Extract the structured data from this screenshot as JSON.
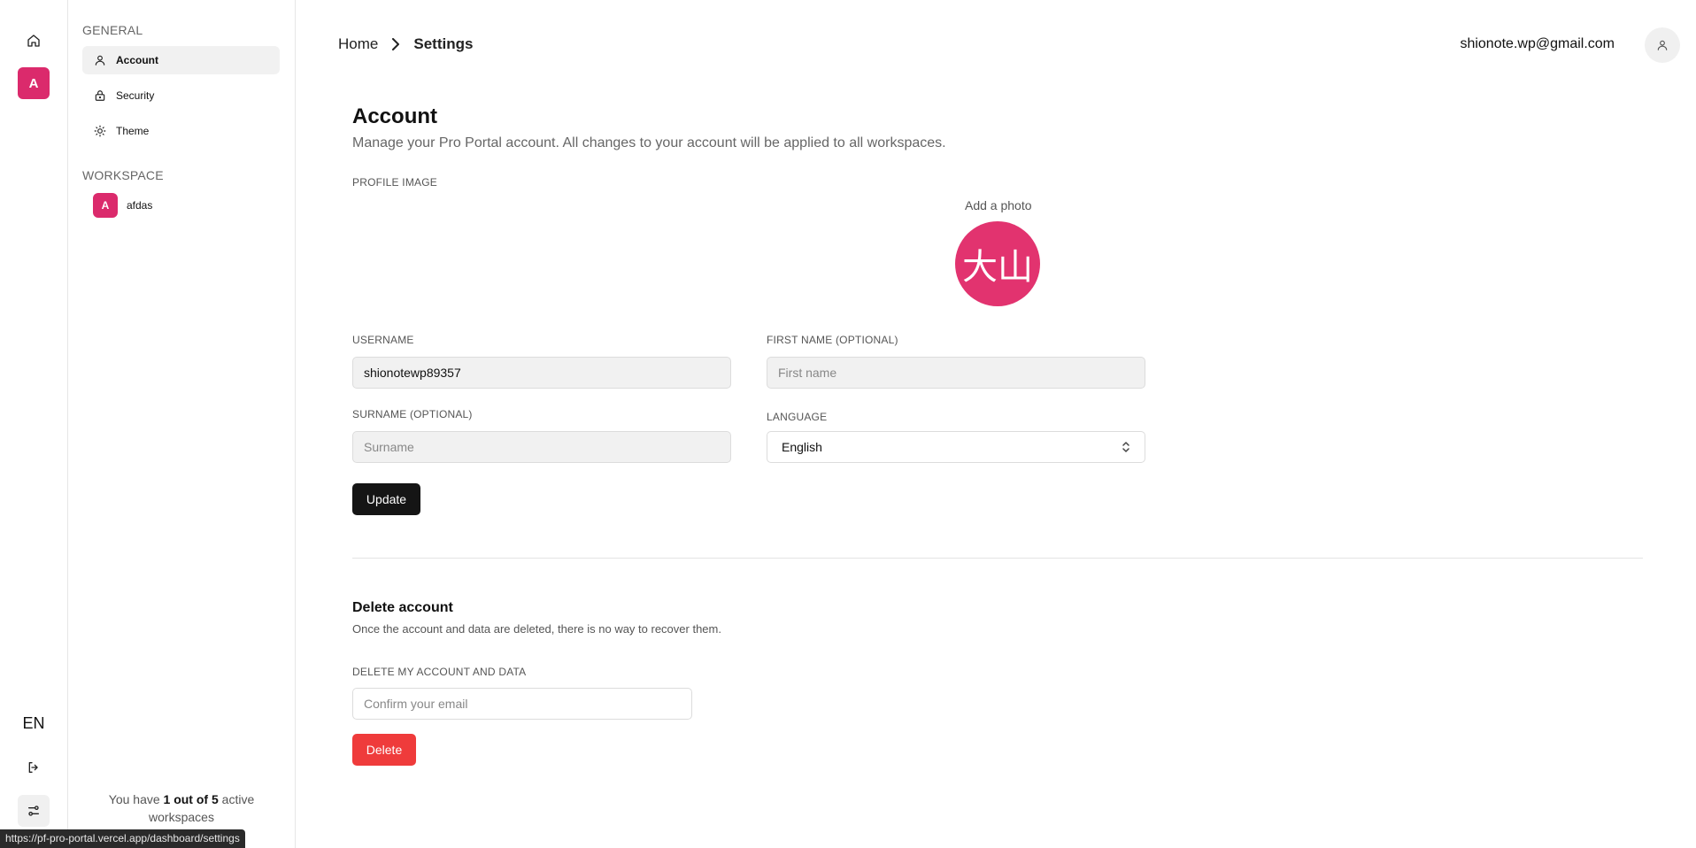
{
  "rail": {
    "home_icon": "home-icon",
    "workspace_initial": "A",
    "language": "EN",
    "logout_icon": "logout-icon",
    "preferences_icon": "sliders-icon"
  },
  "sidebar": {
    "general_title": "GENERAL",
    "items": [
      {
        "label": "Account",
        "icon": "user-icon",
        "active": true
      },
      {
        "label": "Security",
        "icon": "lock-icon",
        "active": false
      },
      {
        "label": "Theme",
        "icon": "sun-icon",
        "active": false
      }
    ],
    "workspace_title": "WORKSPACE",
    "workspace": {
      "initial": "A",
      "name": "afdas"
    },
    "workspace_count": {
      "prefix": "You have ",
      "count": "1 out of 5",
      "suffix": " active workspaces"
    }
  },
  "header": {
    "breadcrumb": {
      "home": "Home",
      "current": "Settings"
    },
    "user_email": "shionote.wp@gmail.com"
  },
  "account": {
    "title": "Account",
    "subtitle": "Manage your Pro Portal account. All changes to your account will be applied to all workspaces.",
    "profile_image_label": "PROFILE IMAGE",
    "add_photo": "Add a photo",
    "avatar_text": "大山",
    "username_label": "USERNAME",
    "username_value": "shionotewp89357",
    "first_name_label": "FIRST NAME (OPTIONAL)",
    "first_name_placeholder": "First name",
    "surname_label": "SURNAME (OPTIONAL)",
    "surname_placeholder": "Surname",
    "language_label": "LANGUAGE",
    "language_value": "English",
    "update_button": "Update"
  },
  "delete_account": {
    "title": "Delete account",
    "description": "Once the account and data are deleted, there is no way to recover them.",
    "field_label": "DELETE MY ACCOUNT AND DATA",
    "placeholder": "Confirm your email",
    "button": "Delete"
  },
  "status_bar": {
    "url": "https://pf-pro-portal.vercel.app/dashboard/settings"
  },
  "colors": {
    "accent": "#db2a6c",
    "danger": "#ef3b3b",
    "primary_button": "#151515"
  }
}
